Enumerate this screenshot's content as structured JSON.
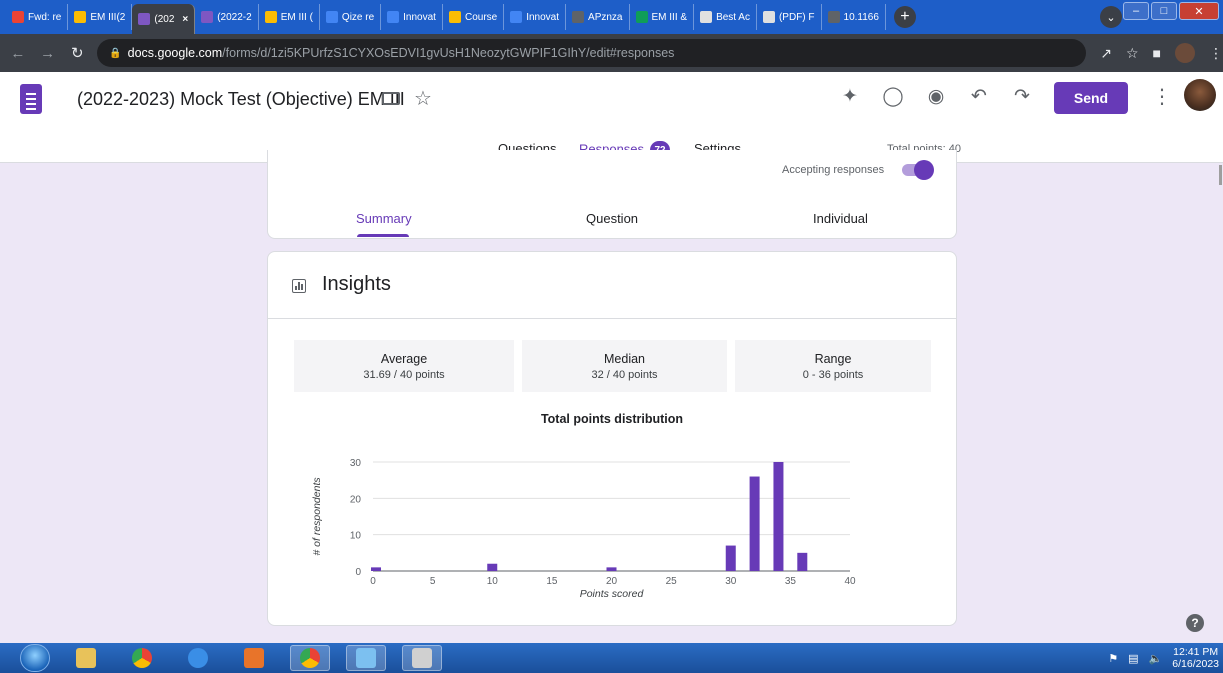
{
  "browser": {
    "tabs": [
      {
        "label": "Fwd: re",
        "color": "#ea4335",
        "active": false
      },
      {
        "label": "EM III(2",
        "color": "#fbbc04",
        "active": false
      },
      {
        "label": "(202",
        "color": "#7e57c2",
        "active": true
      },
      {
        "label": "(2022-2",
        "color": "#7e57c2",
        "active": false
      },
      {
        "label": "EM III (",
        "color": "#fbbc04",
        "active": false
      },
      {
        "label": "Qize re",
        "color": "#4285f4",
        "active": false
      },
      {
        "label": "Innovat",
        "color": "#4285f4",
        "active": false
      },
      {
        "label": "Course",
        "color": "#fbbc04",
        "active": false
      },
      {
        "label": "Innovat",
        "color": "#4285f4",
        "active": false
      },
      {
        "label": "APznza",
        "color": "#5f6368",
        "active": false
      },
      {
        "label": "EM III &",
        "color": "#0f9d58",
        "active": false
      },
      {
        "label": "Best Ac",
        "color": "#e0e0e0",
        "active": false
      },
      {
        "label": "(PDF) F",
        "color": "#e0e0e0",
        "active": false
      },
      {
        "label": "10.1166",
        "color": "#5f6368",
        "active": false
      }
    ],
    "url_host": "docs.google.com",
    "url_path": "/forms/d/1zi5KPUrfzS1CYXOsEDVI1gvUsH1NeozytGWPIF1GIhY/edit#responses"
  },
  "form": {
    "title": "(2022-2023) Mock Test (Objective) EM III",
    "send_label": "Send",
    "tabs": {
      "questions": "Questions",
      "responses": "Responses",
      "settings": "Settings"
    },
    "response_count": "72",
    "total_points": "Total points: 40",
    "accepting": "Accepting responses",
    "subtabs": {
      "summary": "Summary",
      "question": "Question",
      "individual": "Individual"
    }
  },
  "insights": {
    "title": "Insights",
    "stats": [
      {
        "label": "Average",
        "value": "31.69 / 40 points"
      },
      {
        "label": "Median",
        "value": "32 / 40 points"
      },
      {
        "label": "Range",
        "value": "0 - 36 points"
      }
    ]
  },
  "chart_data": {
    "type": "bar",
    "title": "Total points distribution",
    "xlabel": "Points scored",
    "ylabel": "# of respondents",
    "x": [
      0,
      10,
      20,
      30,
      32,
      34,
      36
    ],
    "values": [
      1,
      2,
      1,
      7,
      26,
      30,
      5
    ],
    "xlim": [
      0,
      40
    ],
    "ylim": [
      0,
      30
    ],
    "xticks": [
      0,
      5,
      10,
      15,
      20,
      25,
      30,
      35,
      40
    ],
    "yticks": [
      0,
      10,
      20,
      30
    ],
    "grid": true,
    "bar_color": "#673ab7"
  },
  "taskbar": {
    "time": "12:41 PM",
    "date": "6/16/2023"
  }
}
